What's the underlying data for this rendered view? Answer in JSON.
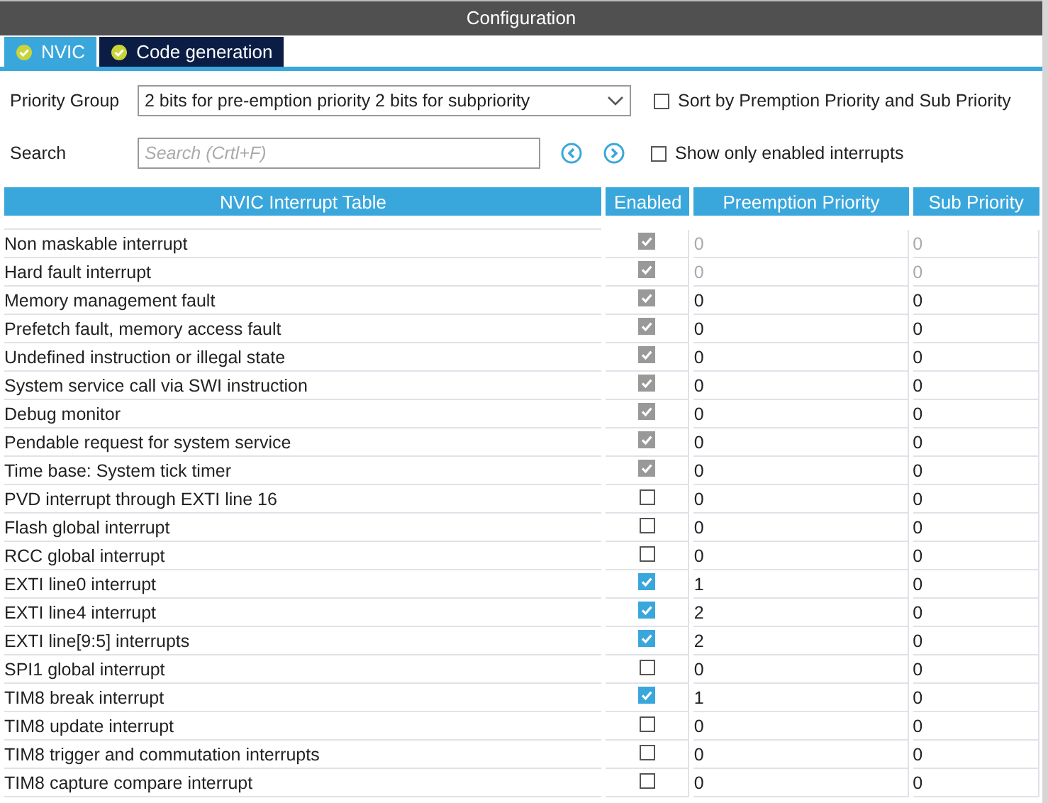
{
  "panel_title": "Configuration",
  "tabs": [
    {
      "label": "NVIC",
      "selected": true
    },
    {
      "label": "Code generation",
      "selected": false
    }
  ],
  "priority_group": {
    "label": "Priority Group",
    "value": "2 bits for pre-emption priority 2 bits for subpriority"
  },
  "sort_option": {
    "label": "Sort by Premption Priority and Sub Priority",
    "checked": false
  },
  "search": {
    "label": "Search",
    "placeholder": "Search (Crtl+F)"
  },
  "enabled_only_option": {
    "label": "Show only enabled interrupts",
    "checked": false
  },
  "table": {
    "columns": [
      "NVIC Interrupt Table",
      "Enabled",
      "Preemption Priority",
      "Sub Priority"
    ],
    "rows": [
      {
        "name": "Non maskable interrupt",
        "enabled": true,
        "disabled": true,
        "priority_disabled": true,
        "preemption": "0",
        "sub": "0"
      },
      {
        "name": "Hard fault interrupt",
        "enabled": true,
        "disabled": true,
        "priority_disabled": true,
        "preemption": "0",
        "sub": "0"
      },
      {
        "name": "Memory management fault",
        "enabled": true,
        "disabled": true,
        "priority_disabled": false,
        "preemption": "0",
        "sub": "0"
      },
      {
        "name": "Prefetch fault, memory access fault",
        "enabled": true,
        "disabled": true,
        "priority_disabled": false,
        "preemption": "0",
        "sub": "0"
      },
      {
        "name": "Undefined instruction or illegal state",
        "enabled": true,
        "disabled": true,
        "priority_disabled": false,
        "preemption": "0",
        "sub": "0"
      },
      {
        "name": "System service call via SWI instruction",
        "enabled": true,
        "disabled": true,
        "priority_disabled": false,
        "preemption": "0",
        "sub": "0"
      },
      {
        "name": "Debug monitor",
        "enabled": true,
        "disabled": true,
        "priority_disabled": false,
        "preemption": "0",
        "sub": "0"
      },
      {
        "name": "Pendable request for system service",
        "enabled": true,
        "disabled": true,
        "priority_disabled": false,
        "preemption": "0",
        "sub": "0"
      },
      {
        "name": "Time base: System tick timer",
        "enabled": true,
        "disabled": true,
        "priority_disabled": false,
        "preemption": "0",
        "sub": "0"
      },
      {
        "name": "PVD interrupt through EXTI line 16",
        "enabled": false,
        "disabled": false,
        "priority_disabled": false,
        "preemption": "0",
        "sub": "0"
      },
      {
        "name": "Flash global interrupt",
        "enabled": false,
        "disabled": false,
        "priority_disabled": false,
        "preemption": "0",
        "sub": "0"
      },
      {
        "name": "RCC global interrupt",
        "enabled": false,
        "disabled": false,
        "priority_disabled": false,
        "preemption": "0",
        "sub": "0"
      },
      {
        "name": "EXTI line0 interrupt",
        "enabled": true,
        "disabled": false,
        "priority_disabled": false,
        "preemption": "1",
        "sub": "0"
      },
      {
        "name": "EXTI line4 interrupt",
        "enabled": true,
        "disabled": false,
        "priority_disabled": false,
        "preemption": "2",
        "sub": "0"
      },
      {
        "name": "EXTI line[9:5] interrupts",
        "enabled": true,
        "disabled": false,
        "priority_disabled": false,
        "preemption": "2",
        "sub": "0"
      },
      {
        "name": "SPI1 global interrupt",
        "enabled": false,
        "disabled": false,
        "priority_disabled": false,
        "preemption": "0",
        "sub": "0"
      },
      {
        "name": "TIM8 break interrupt",
        "enabled": true,
        "disabled": false,
        "priority_disabled": false,
        "preemption": "1",
        "sub": "0"
      },
      {
        "name": "TIM8 update interrupt",
        "enabled": false,
        "disabled": false,
        "priority_disabled": false,
        "preemption": "0",
        "sub": "0"
      },
      {
        "name": "TIM8 trigger and commutation interrupts",
        "enabled": false,
        "disabled": false,
        "priority_disabled": false,
        "preemption": "0",
        "sub": "0"
      },
      {
        "name": "TIM8 capture compare interrupt",
        "enabled": false,
        "disabled": false,
        "priority_disabled": false,
        "preemption": "0",
        "sub": "0"
      }
    ]
  }
}
